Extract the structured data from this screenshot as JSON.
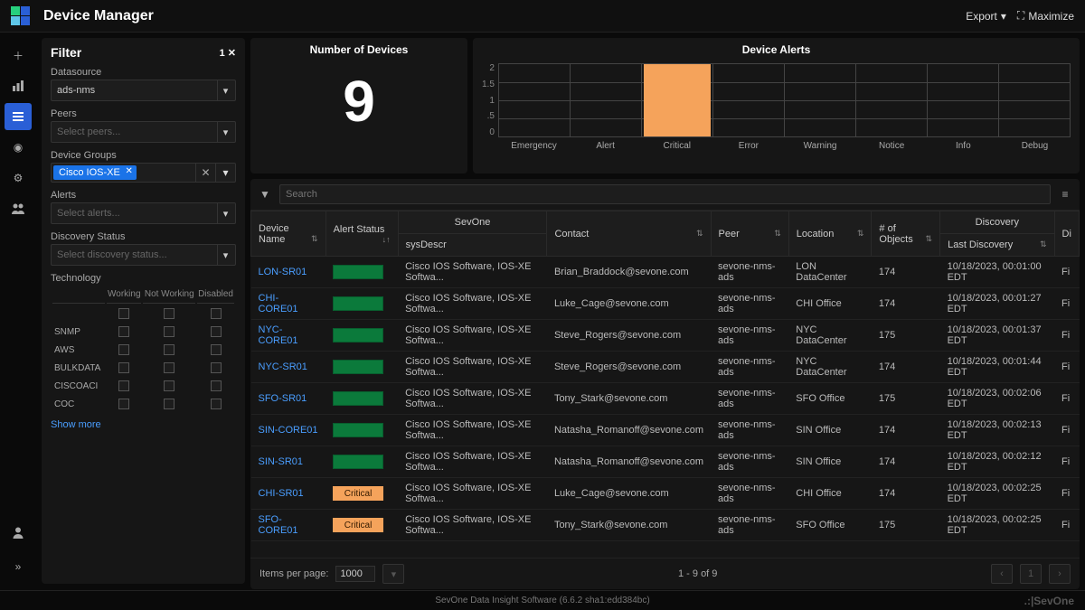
{
  "header": {
    "title": "Device Manager",
    "export": "Export",
    "maximize": "Maximize"
  },
  "filter": {
    "title": "Filter",
    "count": "1",
    "datasource_label": "Datasource",
    "datasource_value": "ads-nms",
    "peers_label": "Peers",
    "peers_placeholder": "Select peers...",
    "devgroups_label": "Device Groups",
    "devgroups_chip": "Cisco IOS-XE",
    "alerts_label": "Alerts",
    "alerts_placeholder": "Select alerts...",
    "discovery_label": "Discovery Status",
    "discovery_placeholder": "Select discovery status...",
    "tech_label": "Technology",
    "cols": {
      "c1": "Working",
      "c2": "Not Working",
      "c3": "Disabled"
    },
    "rows": [
      "SNMP",
      "AWS",
      "BULKDATA",
      "CISCOACI",
      "COC"
    ],
    "show_more": "Show more"
  },
  "cards": {
    "devices_title": "Number of Devices",
    "devices_value": "9",
    "alerts_title": "Device Alerts"
  },
  "chart_data": {
    "type": "bar",
    "categories": [
      "Emergency",
      "Alert",
      "Critical",
      "Error",
      "Warning",
      "Notice",
      "Info",
      "Debug"
    ],
    "values": [
      0,
      0,
      2,
      0,
      0,
      0,
      0,
      0
    ],
    "ylim": [
      0,
      2
    ],
    "yticks": [
      "2",
      "1.5",
      "1",
      ".5",
      "0"
    ]
  },
  "table": {
    "search_placeholder": "Search",
    "headers": {
      "device": "Device Name",
      "alert": "Alert Status",
      "sovone": "SevOne",
      "sys": "sysDescr",
      "contact": "Contact",
      "peer": "Peer",
      "location": "Location",
      "objects": "# of Objects",
      "discovery_group": "Discovery",
      "last_disc": "Last Discovery",
      "di": "Di"
    },
    "rows": [
      {
        "name": "LON-SR01",
        "status": "ok",
        "sys": "Cisco IOS Software, IOS-XE Softwa...",
        "contact": "Brian_Braddock@sevone.com",
        "peer": "sevone-nms-ads",
        "loc": "LON DataCenter",
        "obj": "174",
        "ld": "10/18/2023, 00:01:00 EDT",
        "di": "Fi"
      },
      {
        "name": "CHI-CORE01",
        "status": "ok",
        "sys": "Cisco IOS Software, IOS-XE Softwa...",
        "contact": "Luke_Cage@sevone.com",
        "peer": "sevone-nms-ads",
        "loc": "CHI Office",
        "obj": "174",
        "ld": "10/18/2023, 00:01:27 EDT",
        "di": "Fi"
      },
      {
        "name": "NYC-CORE01",
        "status": "ok",
        "sys": "Cisco IOS Software, IOS-XE Softwa...",
        "contact": "Steve_Rogers@sevone.com",
        "peer": "sevone-nms-ads",
        "loc": "NYC DataCenter",
        "obj": "175",
        "ld": "10/18/2023, 00:01:37 EDT",
        "di": "Fi"
      },
      {
        "name": "NYC-SR01",
        "status": "ok",
        "sys": "Cisco IOS Software, IOS-XE Softwa...",
        "contact": "Steve_Rogers@sevone.com",
        "peer": "sevone-nms-ads",
        "loc": "NYC DataCenter",
        "obj": "174",
        "ld": "10/18/2023, 00:01:44 EDT",
        "di": "Fi"
      },
      {
        "name": "SFO-SR01",
        "status": "ok",
        "sys": "Cisco IOS Software, IOS-XE Softwa...",
        "contact": "Tony_Stark@sevone.com",
        "peer": "sevone-nms-ads",
        "loc": "SFO Office",
        "obj": "175",
        "ld": "10/18/2023, 00:02:06 EDT",
        "di": "Fi"
      },
      {
        "name": "SIN-CORE01",
        "status": "ok",
        "sys": "Cisco IOS Software, IOS-XE Softwa...",
        "contact": "Natasha_Romanoff@sevone.com",
        "peer": "sevone-nms-ads",
        "loc": "SIN Office",
        "obj": "174",
        "ld": "10/18/2023, 00:02:13 EDT",
        "di": "Fi"
      },
      {
        "name": "SIN-SR01",
        "status": "ok",
        "sys": "Cisco IOS Software, IOS-XE Softwa...",
        "contact": "Natasha_Romanoff@sevone.com",
        "peer": "sevone-nms-ads",
        "loc": "SIN Office",
        "obj": "174",
        "ld": "10/18/2023, 00:02:12 EDT",
        "di": "Fi"
      },
      {
        "name": "CHI-SR01",
        "status": "crit",
        "sys": "Cisco IOS Software, IOS-XE Softwa...",
        "contact": "Luke_Cage@sevone.com",
        "peer": "sevone-nms-ads",
        "loc": "CHI Office",
        "obj": "174",
        "ld": "10/18/2023, 00:02:25 EDT",
        "di": "Fi"
      },
      {
        "name": "SFO-CORE01",
        "status": "crit",
        "sys": "Cisco IOS Software, IOS-XE Softwa...",
        "contact": "Tony_Stark@sevone.com",
        "peer": "sevone-nms-ads",
        "loc": "SFO Office",
        "obj": "175",
        "ld": "10/18/2023, 00:02:25 EDT",
        "di": "Fi"
      }
    ],
    "critical_label": "Critical"
  },
  "pager": {
    "items_label": "Items per page:",
    "items_value": "1000",
    "range": "1 - 9 of 9",
    "page": "1"
  },
  "footer": {
    "text": "SevOne Data Insight Software (6.6.2 sha1:edd384bc)",
    "brand": ".:|SevOne"
  }
}
